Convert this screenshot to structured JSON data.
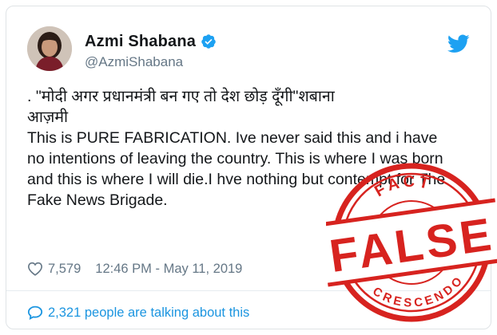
{
  "author": {
    "display_name": "Azmi Shabana",
    "handle": "@AzmiShabana",
    "verified": true
  },
  "tweet": {
    "line1": ". \"मोदी अगर प्रधानमंत्री बन गए तो देश छोड़ दूँगी\"शबाना",
    "line2": "आज़मी",
    "body": "This is PURE FABRICATION. Ive never said this and i have no intentions of leaving the country. This is where I was born and this is where I will die.I hve nothing but contempt for The Fake News Brigade."
  },
  "meta": {
    "likes": "7,579",
    "timestamp": "12:46 PM - May 11, 2019"
  },
  "engagement": {
    "talking": "2,321 people are talking about this"
  },
  "stamp": {
    "top_text": "FACT",
    "main_text": "FALSE",
    "bottom_text": "CRESCENDO",
    "color": "#d7231f"
  },
  "icons": {
    "verified": "verified-badge-icon",
    "brand": "twitter-bird-icon",
    "like": "heart-icon",
    "comment": "speech-bubble-icon"
  },
  "colors": {
    "link_blue": "#1b95e0",
    "verified_blue": "#1da1f2",
    "muted": "#657786"
  }
}
